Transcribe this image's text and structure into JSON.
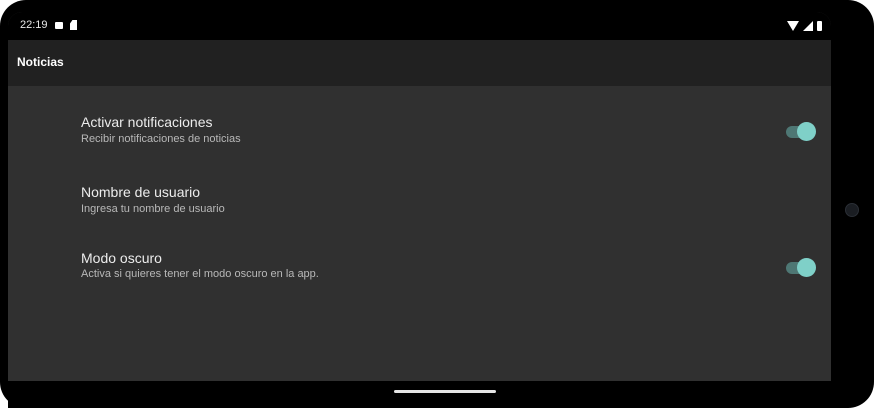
{
  "status_bar": {
    "time": "22:19",
    "icons": [
      "photo-icon",
      "sd-card-icon",
      "wifi-icon",
      "signal-icon",
      "battery-icon"
    ]
  },
  "app_bar": {
    "title": "Noticias"
  },
  "preferences": [
    {
      "title": "Activar notificaciones",
      "summary": "Recibir notificaciones de noticias",
      "has_switch": true,
      "switch_on": true
    },
    {
      "title": "Nombre de usuario",
      "summary": "Ingresa tu nombre de usuario",
      "has_switch": false
    },
    {
      "title": "Modo oscuro",
      "summary": "Activa si quieres tener el modo oscuro en la app.",
      "has_switch": true,
      "switch_on": true
    }
  ],
  "colors": {
    "background": "#303030",
    "app_bar": "#212121",
    "switch_thumb": "#7fd0c8",
    "switch_track": "#4e7774"
  }
}
